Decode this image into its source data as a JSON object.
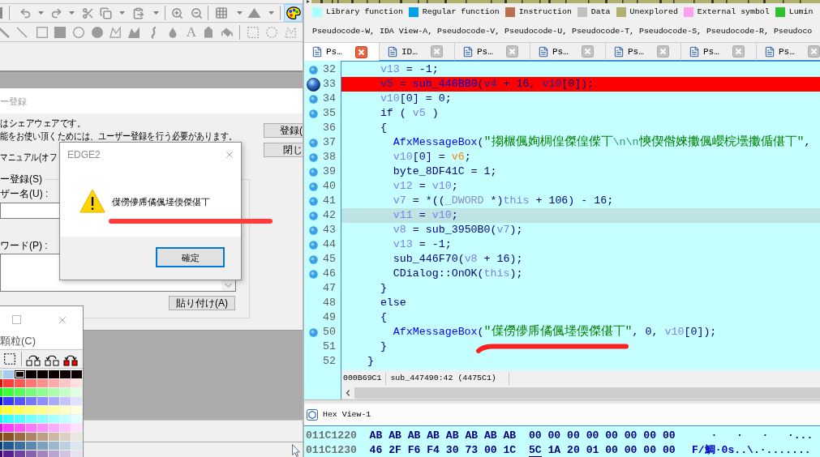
{
  "edge2": {
    "toolbar": {
      "palette_button": {
        "selected": true
      }
    },
    "draw_tools": {
      "text_tool": "A"
    },
    "registration": {
      "title": "ー登録",
      "lines": [
        "はシェアウェアです。",
        "能をお使い頂くためには、ユーザー登録を行う必要があります。",
        "マニュアル(オフ"
      ],
      "buttons": [
        "登録(",
        "閉じ"
      ],
      "group_label": "ー登録(S)",
      "username_label": "ザー名(U) :",
      "password_label": "ワード(P) :",
      "paste_button": "貼り付け(A)"
    },
    "message_box": {
      "title": "EDGE2",
      "message": "僷僗儚乕僪偑堘偄傑偡丅",
      "ok_button": "確定"
    },
    "palette": {
      "menu": "顆粒(C)",
      "rows": [
        {
          "swatches": [
            {
              "color": "#c0dcc0",
              "selected": false
            },
            {
              "color": "#a6caf0",
              "selected": false
            },
            {
              "color": "#0a0000",
              "selected": true
            },
            {
              "color": "#0a0000",
              "selected": false
            },
            {
              "color": "#0a0000",
              "selected": false
            },
            {
              "color": "#0a0000",
              "selected": false
            },
            {
              "color": "#0a0000",
              "selected": false
            },
            {
              "color": "#0a0000",
              "selected": false
            }
          ]
        },
        {
          "swatches": [
            {
              "color": "#ff0000",
              "selected": false
            },
            {
              "color": "#ff3c3c",
              "selected": false
            },
            {
              "color": "#ff5656",
              "selected": false
            },
            {
              "color": "#ff7676",
              "selected": false
            },
            {
              "color": "#ff8e8e",
              "selected": false
            },
            {
              "color": "#ffaaaa",
              "selected": false
            },
            {
              "color": "#ffc4c4",
              "selected": false
            },
            {
              "color": "#ffe0e0",
              "selected": false
            }
          ]
        },
        {
          "swatches": [
            {
              "color": "#00ff00",
              "selected": false
            },
            {
              "color": "#3cff3c",
              "selected": false
            },
            {
              "color": "#56ff56",
              "selected": false
            },
            {
              "color": "#76ff76",
              "selected": false
            },
            {
              "color": "#8eff8e",
              "selected": false
            },
            {
              "color": "#aaffaa",
              "selected": false
            },
            {
              "color": "#c4ffc4",
              "selected": false
            },
            {
              "color": "#e0ffe0",
              "selected": false
            }
          ]
        },
        {
          "swatches": [
            {
              "color": "#0000ff",
              "selected": false
            },
            {
              "color": "#3c3cff",
              "selected": false
            },
            {
              "color": "#5656ff",
              "selected": false
            },
            {
              "color": "#7676ff",
              "selected": false
            },
            {
              "color": "#8e8eff",
              "selected": false
            },
            {
              "color": "#aaaaff",
              "selected": false
            },
            {
              "color": "#c4c4ff",
              "selected": false
            },
            {
              "color": "#e0e0ff",
              "selected": false
            }
          ]
        },
        {
          "swatches": [
            {
              "color": "#ffff00",
              "selected": false
            },
            {
              "color": "#ffff3c",
              "selected": false
            },
            {
              "color": "#ffff56",
              "selected": false
            },
            {
              "color": "#ffff76",
              "selected": false
            },
            {
              "color": "#ffff8e",
              "selected": false
            },
            {
              "color": "#ffffaa",
              "selected": false
            },
            {
              "color": "#ffffc4",
              "selected": false
            },
            {
              "color": "#ffffe0",
              "selected": false
            }
          ]
        },
        {
          "swatches": [
            {
              "color": "#00ffff",
              "selected": false
            },
            {
              "color": "#3cffff",
              "selected": false
            },
            {
              "color": "#56ffff",
              "selected": false
            },
            {
              "color": "#76ffff",
              "selected": false
            },
            {
              "color": "#8effff",
              "selected": false
            },
            {
              "color": "#aaffff",
              "selected": false
            },
            {
              "color": "#c4ffff",
              "selected": false
            },
            {
              "color": "#e0ffff",
              "selected": false
            }
          ]
        },
        {
          "swatches": [
            {
              "color": "#ff00ff",
              "selected": false
            },
            {
              "color": "#ff3cff",
              "selected": false
            },
            {
              "color": "#ff56ff",
              "selected": false
            },
            {
              "color": "#ff76ff",
              "selected": false
            },
            {
              "color": "#ff8eff",
              "selected": false
            },
            {
              "color": "#ffaaff",
              "selected": false
            },
            {
              "color": "#ffc4ff",
              "selected": false
            },
            {
              "color": "#ffe0ff",
              "selected": false
            }
          ]
        },
        {
          "swatches": [
            {
              "color": "#804000",
              "selected": false
            },
            {
              "color": "#8c5424",
              "selected": false
            },
            {
              "color": "#9c6c44",
              "selected": false
            },
            {
              "color": "#ac8664",
              "selected": false
            },
            {
              "color": "#bca084",
              "selected": false
            },
            {
              "color": "#ccb8a4",
              "selected": false
            },
            {
              "color": "#dcd0c4",
              "selected": false
            },
            {
              "color": "#ece6e0",
              "selected": false
            }
          ]
        },
        {
          "swatches": [
            {
              "color": "#004080",
              "selected": false
            },
            {
              "color": "#205a90",
              "selected": false
            },
            {
              "color": "#3c70a0",
              "selected": false
            },
            {
              "color": "#5c88b0",
              "selected": false
            },
            {
              "color": "#7ca0c0",
              "selected": false
            },
            {
              "color": "#9cb8d0",
              "selected": false
            },
            {
              "color": "#bcd0e0",
              "selected": false
            },
            {
              "color": "#dce6ee",
              "selected": false
            }
          ]
        },
        {
          "swatches": [
            {
              "color": "#400080",
              "selected": false
            },
            {
              "color": "#582090",
              "selected": false
            },
            {
              "color": "#6e44a0",
              "selected": false
            },
            {
              "color": "#8864b0",
              "selected": false
            },
            {
              "color": "#a084c0",
              "selected": false
            },
            {
              "color": "#b8a4d0",
              "selected": false
            },
            {
              "color": "#d0c4e0",
              "selected": false
            },
            {
              "color": "#e8e2ee",
              "selected": false
            }
          ]
        }
      ]
    }
  },
  "ida": {
    "legend": [
      {
        "label": "Library function",
        "color": "#a8ffff"
      },
      {
        "label": "Regular function",
        "color": "#00a0e8"
      },
      {
        "label": "Instruction",
        "color": "#b87050"
      },
      {
        "label": "Data",
        "color": "#c0c0c0"
      },
      {
        "label": "Unexplored",
        "color": "#b0b070"
      },
      {
        "label": "External symbol",
        "color": "#ffa0f0"
      },
      {
        "label": "Lumin",
        "color": "#30c030"
      }
    ],
    "open_views": "Pseudocode-W, IDA View-A, Pseudocode-V, Pseudocode-U, Pseudocode-T, Pseudocode-S, Pseudocode-R, Pseudoco",
    "tabs": [
      {
        "label": "Ps…",
        "selected": true
      },
      {
        "label": "ID…",
        "selected": false
      },
      {
        "label": "Ps…",
        "selected": false
      },
      {
        "label": "Ps…",
        "selected": false
      },
      {
        "label": "Ps…",
        "selected": false
      },
      {
        "label": "Ps…",
        "selected": false
      },
      {
        "label": "Ps…",
        "selected": false
      }
    ],
    "code_lines": [
      {
        "number": "32",
        "executable": true,
        "breakpoint": false,
        "current": false,
        "tokens": [
          {
            "kind": "var",
            "text": "      v13"
          },
          {
            "kind": "plain",
            "text": " = -1;"
          }
        ]
      },
      {
        "number": "33",
        "executable": true,
        "breakpoint": true,
        "current": false,
        "tokens": [
          {
            "kind": "var",
            "text": "      v5"
          },
          {
            "kind": "plain",
            "text": " = "
          },
          {
            "kind": "func",
            "text": "sub_446BB0"
          },
          {
            "kind": "plain",
            "text": "("
          },
          {
            "kind": "var",
            "text": "v4"
          },
          {
            "kind": "plain",
            "text": " + 16, "
          },
          {
            "kind": "var",
            "text": "v10"
          },
          {
            "kind": "plain",
            "text": "[0]);"
          }
        ]
      },
      {
        "number": "34",
        "executable": true,
        "breakpoint": false,
        "current": false,
        "tokens": [
          {
            "kind": "var",
            "text": "      v10"
          },
          {
            "kind": "plain",
            "text": "[0] = 0;"
          }
        ]
      },
      {
        "number": "35",
        "executable": true,
        "breakpoint": false,
        "current": false,
        "tokens": [
          {
            "kind": "plain",
            "text": "      if ( "
          },
          {
            "kind": "var",
            "text": "v5"
          },
          {
            "kind": "plain",
            "text": " )"
          }
        ]
      },
      {
        "number": "36",
        "executable": false,
        "breakpoint": false,
        "current": false,
        "tokens": [
          {
            "kind": "plain",
            "text": "      {"
          }
        ]
      },
      {
        "number": "37",
        "executable": true,
        "breakpoint": false,
        "current": false,
        "tokens": [
          {
            "kind": "func",
            "text": "        AfxMessageBox"
          },
          {
            "kind": "plain",
            "text": "("
          },
          {
            "kind": "string",
            "text": "\"搊榐偑姰椆偟傑偟偨丅"
          },
          {
            "kind": "escape",
            "text": "\\n\\n"
          },
          {
            "kind": "string",
            "text": "慡偰偺婡擻偑巊梡壜擻偱偡丅\""
          },
          {
            "kind": "plain",
            "text": ","
          }
        ]
      },
      {
        "number": "38",
        "executable": true,
        "breakpoint": false,
        "current": false,
        "tokens": [
          {
            "kind": "var",
            "text": "        v10"
          },
          {
            "kind": "plain",
            "text": "[0] = "
          },
          {
            "kind": "arg",
            "text": "v6"
          },
          {
            "kind": "plain",
            "text": ";"
          }
        ]
      },
      {
        "number": "39",
        "executable": true,
        "breakpoint": false,
        "current": false,
        "tokens": [
          {
            "kind": "plain",
            "text": "        byte_8DF41C = 1;"
          }
        ]
      },
      {
        "number": "40",
        "executable": true,
        "breakpoint": false,
        "current": false,
        "tokens": [
          {
            "kind": "var",
            "text": "        v12"
          },
          {
            "kind": "plain",
            "text": " = "
          },
          {
            "kind": "var",
            "text": "v10"
          },
          {
            "kind": "plain",
            "text": ";"
          }
        ]
      },
      {
        "number": "41",
        "executable": true,
        "breakpoint": false,
        "current": false,
        "tokens": [
          {
            "kind": "var",
            "text": "        v7"
          },
          {
            "kind": "plain",
            "text": " = *(("
          },
          {
            "kind": "type",
            "text": "_DWORD"
          },
          {
            "kind": "plain",
            "text": " *)"
          },
          {
            "kind": "var",
            "text": "this"
          },
          {
            "kind": "plain",
            "text": " + 106) - 16;"
          }
        ]
      },
      {
        "number": "42",
        "executable": true,
        "breakpoint": false,
        "current": true,
        "tokens": [
          {
            "kind": "var",
            "text": "        v11"
          },
          {
            "kind": "plain",
            "text": " = "
          },
          {
            "kind": "var",
            "text": "v10"
          },
          {
            "kind": "plain",
            "text": ";"
          }
        ]
      },
      {
        "number": "43",
        "executable": true,
        "breakpoint": false,
        "current": false,
        "tokens": [
          {
            "kind": "var",
            "text": "        v8"
          },
          {
            "kind": "plain",
            "text": " = sub_3950B0("
          },
          {
            "kind": "var",
            "text": "v7"
          },
          {
            "kind": "plain",
            "text": ");"
          }
        ]
      },
      {
        "number": "44",
        "executable": true,
        "breakpoint": false,
        "current": false,
        "tokens": [
          {
            "kind": "var",
            "text": "        v13"
          },
          {
            "kind": "plain",
            "text": " = -1;"
          }
        ]
      },
      {
        "number": "45",
        "executable": true,
        "breakpoint": false,
        "current": false,
        "tokens": [
          {
            "kind": "plain",
            "text": "        sub_446F70("
          },
          {
            "kind": "var",
            "text": "v8"
          },
          {
            "kind": "plain",
            "text": " + 16);"
          }
        ]
      },
      {
        "number": "46",
        "executable": true,
        "breakpoint": false,
        "current": false,
        "tokens": [
          {
            "kind": "plain",
            "text": "        CDialog::OnOK("
          },
          {
            "kind": "var",
            "text": "this"
          },
          {
            "kind": "plain",
            "text": ");"
          }
        ]
      },
      {
        "number": "47",
        "executable": false,
        "breakpoint": false,
        "current": false,
        "tokens": [
          {
            "kind": "plain",
            "text": "      }"
          }
        ]
      },
      {
        "number": "48",
        "executable": false,
        "breakpoint": false,
        "current": false,
        "tokens": [
          {
            "kind": "plain",
            "text": "      else"
          }
        ]
      },
      {
        "number": "49",
        "executable": false,
        "breakpoint": false,
        "current": false,
        "tokens": [
          {
            "kind": "plain",
            "text": "      {"
          }
        ]
      },
      {
        "number": "50",
        "executable": true,
        "breakpoint": false,
        "current": false,
        "tokens": [
          {
            "kind": "func",
            "text": "        AfxMessageBox"
          },
          {
            "kind": "plain",
            "text": "("
          },
          {
            "kind": "string",
            "text": "\"僷僗儚乕僪偑堘偄傑偡丅\""
          },
          {
            "kind": "plain",
            "text": ", 0, "
          },
          {
            "kind": "var",
            "text": "v10"
          },
          {
            "kind": "plain",
            "text": "[0]);"
          }
        ]
      },
      {
        "number": "51",
        "executable": false,
        "breakpoint": false,
        "current": false,
        "tokens": [
          {
            "kind": "plain",
            "text": "      }"
          }
        ]
      },
      {
        "number": "52",
        "executable": false,
        "breakpoint": false,
        "current": false,
        "tokens": [
          {
            "kind": "plain",
            "text": "    }"
          }
        ]
      }
    ],
    "status": {
      "address": "000B69C1",
      "location": "sub_447490:42 (4475C1)"
    },
    "hex_view": {
      "title": "Hex View-1",
      "rows": [
        {
          "address": "011C1220",
          "bytes": [
            {
              "text": "AB",
              "selected": false
            },
            {
              "text": "AB",
              "selected": false
            },
            {
              "text": "AB",
              "selected": false
            },
            {
              "text": "AB",
              "selected": false
            },
            {
              "text": "AB",
              "selected": false
            },
            {
              "text": "AB",
              "selected": false
            },
            {
              "text": "AB",
              "selected": false
            },
            {
              "text": "AB",
              "selected": false
            },
            {
              "text": "00",
              "selected": false
            },
            {
              "text": "00",
              "selected": false
            },
            {
              "text": "00",
              "selected": false
            },
            {
              "text": "00",
              "selected": false
            },
            {
              "text": "00",
              "selected": false
            },
            {
              "text": "00",
              "selected": false
            },
            {
              "text": "00",
              "selected": false
            },
            {
              "text": "00",
              "selected": false
            }
          ],
          "ascii": "   ·   ·   ·   ·..."
        },
        {
          "address": "011C1230",
          "bytes": [
            {
              "text": "46",
              "selected": false
            },
            {
              "text": "2F",
              "selected": false
            },
            {
              "text": "F6",
              "selected": false
            },
            {
              "text": "F4",
              "selected": false
            },
            {
              "text": "30",
              "selected": false
            },
            {
              "text": "73",
              "selected": false
            },
            {
              "text": "00",
              "selected": false
            },
            {
              "text": "1C",
              "selected": false
            },
            {
              "text": "5C",
              "selected": true
            },
            {
              "text": "1A",
              "selected": false
            },
            {
              "text": "20",
              "selected": false
            },
            {
              "text": "01",
              "selected": false
            },
            {
              "text": "00",
              "selected": false
            },
            {
              "text": "00",
              "selected": false
            },
            {
              "text": "00",
              "selected": false
            },
            {
              "text": "00",
              "selected": false
            }
          ],
          "ascii": "F/鯛·0s..\\.·......."
        }
      ]
    }
  }
}
